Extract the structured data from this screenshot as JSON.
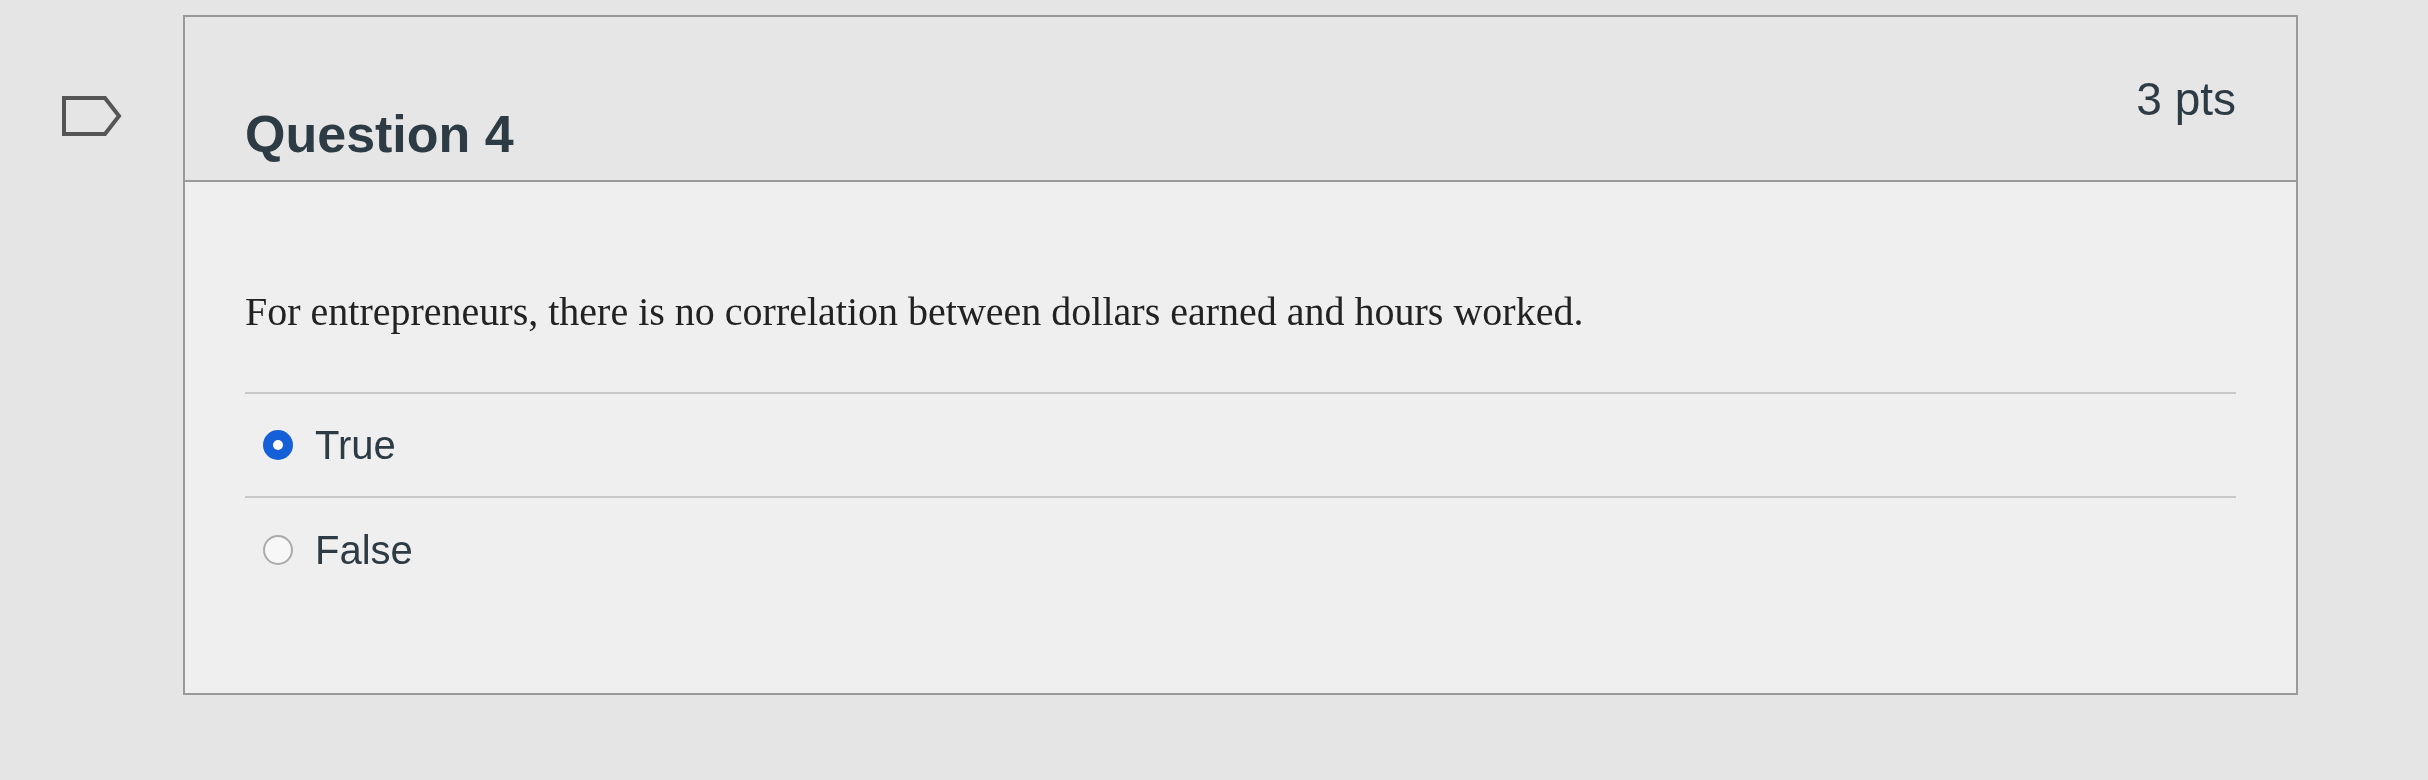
{
  "question": {
    "title": "Question 4",
    "points": "3 pts",
    "flagged": false,
    "text": "For entrepreneurs, there is no correlation between dollars earned and hours worked.",
    "options": [
      {
        "label": "True",
        "selected": true
      },
      {
        "label": "False",
        "selected": false
      }
    ]
  }
}
